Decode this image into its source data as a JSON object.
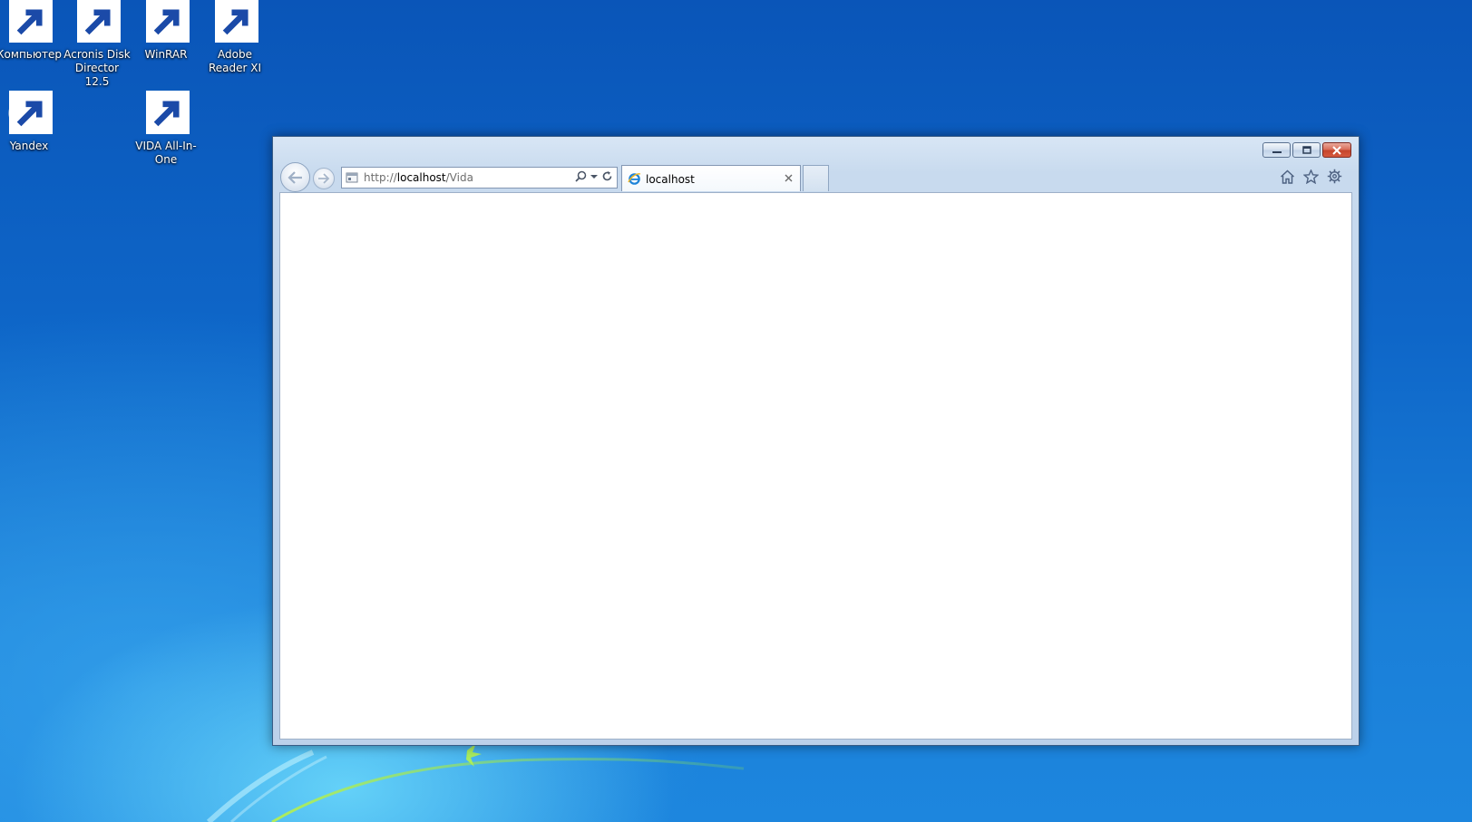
{
  "desktop": {
    "icons": [
      {
        "label": "Компьютер",
        "icon": "computer-icon"
      },
      {
        "label": "Acronis Disk Director 12.5",
        "icon": "acronis-icon"
      },
      {
        "label": "WinRAR",
        "icon": "winrar-icon"
      },
      {
        "label": "Adobe Reader XI",
        "icon": "adobe-reader-icon"
      },
      {
        "label": "Yandex",
        "icon": "yandex-icon"
      },
      {
        "label": "VIDA All-In-One",
        "icon": "vida-icon"
      }
    ]
  },
  "browser": {
    "address": {
      "scheme": "http://",
      "host": "localhost",
      "path": "/Vida"
    },
    "tabs": [
      {
        "title": "localhost",
        "icon": "ie-icon"
      }
    ],
    "toolbar_icons": [
      "home-icon",
      "star-icon",
      "gear-icon"
    ],
    "caption_buttons": [
      "minimize-icon",
      "restore-icon",
      "close-icon"
    ]
  }
}
